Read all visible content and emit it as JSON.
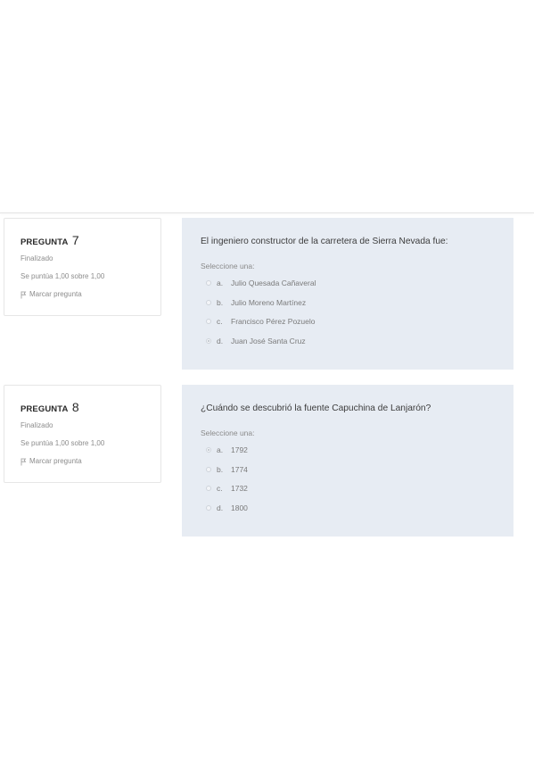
{
  "questions": [
    {
      "label": "PREGUNTA",
      "number": "7",
      "state": "Finalizado",
      "grade": "Se puntúa 1,00 sobre 1,00",
      "flag_label": "Marcar pregunta",
      "text": "El ingeniero constructor de la carretera de Sierra Nevada fue:",
      "prompt": "Seleccione una:",
      "answers": [
        {
          "letter": "a.",
          "text": "Julio Quesada Cañaveral",
          "checked": false
        },
        {
          "letter": "b.",
          "text": "Julio Moreno Martínez",
          "checked": false
        },
        {
          "letter": "c.",
          "text": "Francisco Pérez Pozuelo",
          "checked": false
        },
        {
          "letter": "d.",
          "text": "Juan José Santa Cruz",
          "checked": true
        }
      ]
    },
    {
      "label": "PREGUNTA",
      "number": "8",
      "state": "Finalizado",
      "grade": "Se puntúa 1,00 sobre 1,00",
      "flag_label": "Marcar pregunta",
      "text": "¿Cuándo se descubrió la fuente Capuchina de Lanjarón?",
      "prompt": "Seleccione una:",
      "answers": [
        {
          "letter": "a.",
          "text": "1792",
          "checked": true
        },
        {
          "letter": "b.",
          "text": "1774",
          "checked": false
        },
        {
          "letter": "c.",
          "text": "1732",
          "checked": false
        },
        {
          "letter": "d.",
          "text": "1800",
          "checked": false
        }
      ]
    }
  ]
}
